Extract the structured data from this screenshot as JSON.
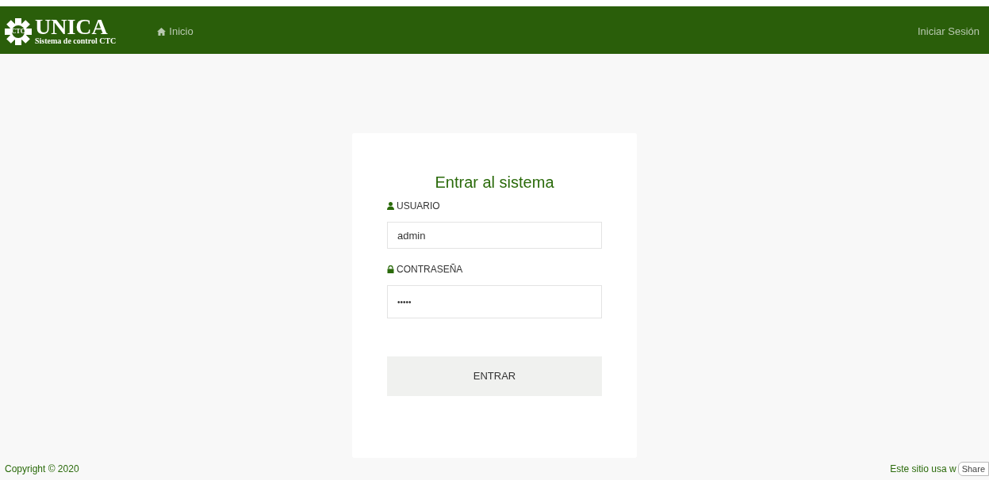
{
  "navbar": {
    "logo_badge": "CTC",
    "brand": "UNICA",
    "subtitle": "Sistema de control CTC",
    "nav_link": "Inicio",
    "login_link": "Iniciar Sesión"
  },
  "login_card": {
    "title": "Entrar al sistema",
    "fields": [
      {
        "kind": "user",
        "label": "USUARIO",
        "value": "admin"
      },
      {
        "kind": "password",
        "label": "CONTRASEÑA",
        "value": "•••••"
      }
    ],
    "submit": "ENTRAR"
  },
  "footer": {
    "copyright": "Copyright © 2020",
    "notice": "Este sitio usa w",
    "share": "Share"
  }
}
